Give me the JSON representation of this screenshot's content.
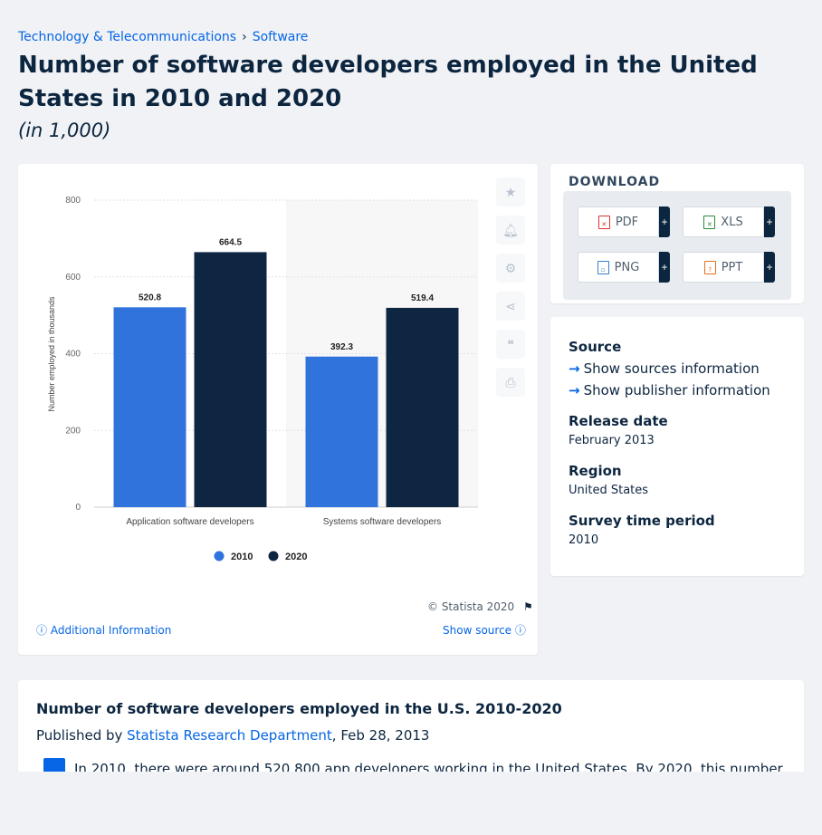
{
  "breadcrumb": {
    "parent": "Technology & Telecommunications",
    "current": "Software"
  },
  "title": "Number of software developers employed in the United States in 2010 and 2020",
  "subtitle": "(in 1,000)",
  "chart_data": {
    "type": "bar",
    "categories": [
      "Application software developers",
      "Systems software developers"
    ],
    "series": [
      {
        "name": "2010",
        "values": [
          520.8,
          392.3
        ],
        "color": "#3173dd"
      },
      {
        "name": "2020",
        "values": [
          664.5,
          519.4
        ],
        "color": "#0f2642"
      }
    ],
    "ylabel": "Number employed in thousands",
    "ylim": [
      0,
      800
    ],
    "yticks": [
      0,
      200,
      400,
      600,
      800
    ],
    "value_labels": [
      "520.8",
      "664.5",
      "392.3",
      "519.4"
    ],
    "grid": true,
    "legend": "bottom-center"
  },
  "chart_footer": {
    "copyright": "© Statista 2020",
    "additional_info": "Additional Information",
    "show_source": "Show source"
  },
  "download": {
    "title": "DOWNLOAD",
    "buttons": [
      "PDF",
      "XLS",
      "PNG",
      "PPT"
    ],
    "plus": "+"
  },
  "info": {
    "source_label": "Source",
    "show_sources": "Show sources information",
    "show_publisher": "Show publisher information",
    "release_label": "Release date",
    "release_value": "February 2013",
    "region_label": "Region",
    "region_value": "United States",
    "period_label": "Survey time period",
    "period_value": "2010"
  },
  "description": {
    "title": "Number of software developers employed in the U.S. 2010-2020",
    "published_prefix": "Published by ",
    "publisher": "Statista Research Department",
    "date": ", Feb 28, 2013",
    "text": "In 2010, there were around 520,800 app developers working in the United States. By 2020, this number"
  },
  "colors": {
    "accent": "#0666e5",
    "dark": "#0d2640"
  }
}
